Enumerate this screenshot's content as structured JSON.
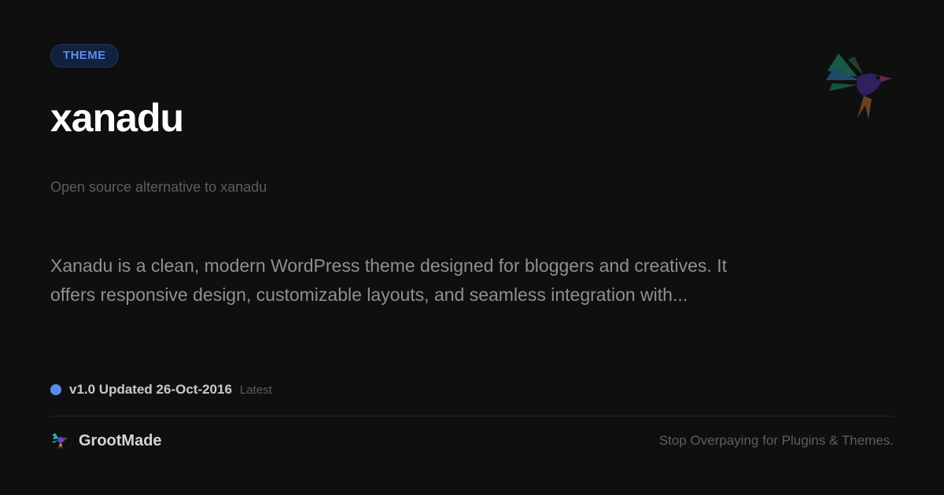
{
  "badge": {
    "label": "THEME"
  },
  "product": {
    "name": "xanadu",
    "subtitle": "Open source alternative  to xanadu",
    "description": "Xanadu is a clean, modern WordPress  theme designed for bloggers and creatives. It offers responsive  design, customizable layouts, and seamless integration  with..."
  },
  "release": {
    "version_info": "v1.0 Updated 26-Oct-2016",
    "tag": "Latest"
  },
  "footer": {
    "brand_name": "GrootMade",
    "tagline": "Stop Overpaying  for Plugins & Themes."
  },
  "icons": {
    "top_logo": "hummingbird-logo-icon",
    "brand_logo": "hummingbird-logo-icon",
    "status": "status-dot-icon"
  },
  "colors": {
    "background": "#0f0f10",
    "accent": "#5b8def",
    "badge_bg": "#12213d",
    "title": "#ffffff",
    "muted": "#5d5d62",
    "body_text": "#8f8f94"
  }
}
